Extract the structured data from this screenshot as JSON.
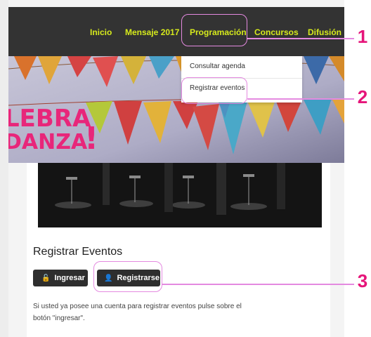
{
  "nav": {
    "items": [
      {
        "label": "Inicio"
      },
      {
        "label": "Mensaje 2017"
      },
      {
        "label": "Programación"
      },
      {
        "label": "Concursos"
      },
      {
        "label": "Difusión"
      }
    ]
  },
  "hero": {
    "text_line1": "LEBRA",
    "text_line2": "DANZA",
    "exclaim": "!"
  },
  "dropdown": {
    "items": [
      {
        "label": "Consultar agenda"
      },
      {
        "label": "Registrar eventos"
      }
    ]
  },
  "content": {
    "title": "Registrar Eventos",
    "login_label": "Ingresar",
    "register_label": "Registrarse",
    "description": "Si usted ya posee una cuenta para registrar eventos pulse sobre el botón \"ingresar\"."
  },
  "callouts": [
    "1",
    "2",
    "3"
  ],
  "colors": {
    "nav_bg": "#333333",
    "nav_text": "#d6ea1c",
    "button_bg": "#2e2e2e",
    "highlight": "#e48ae0",
    "callout": "#e6157a"
  }
}
